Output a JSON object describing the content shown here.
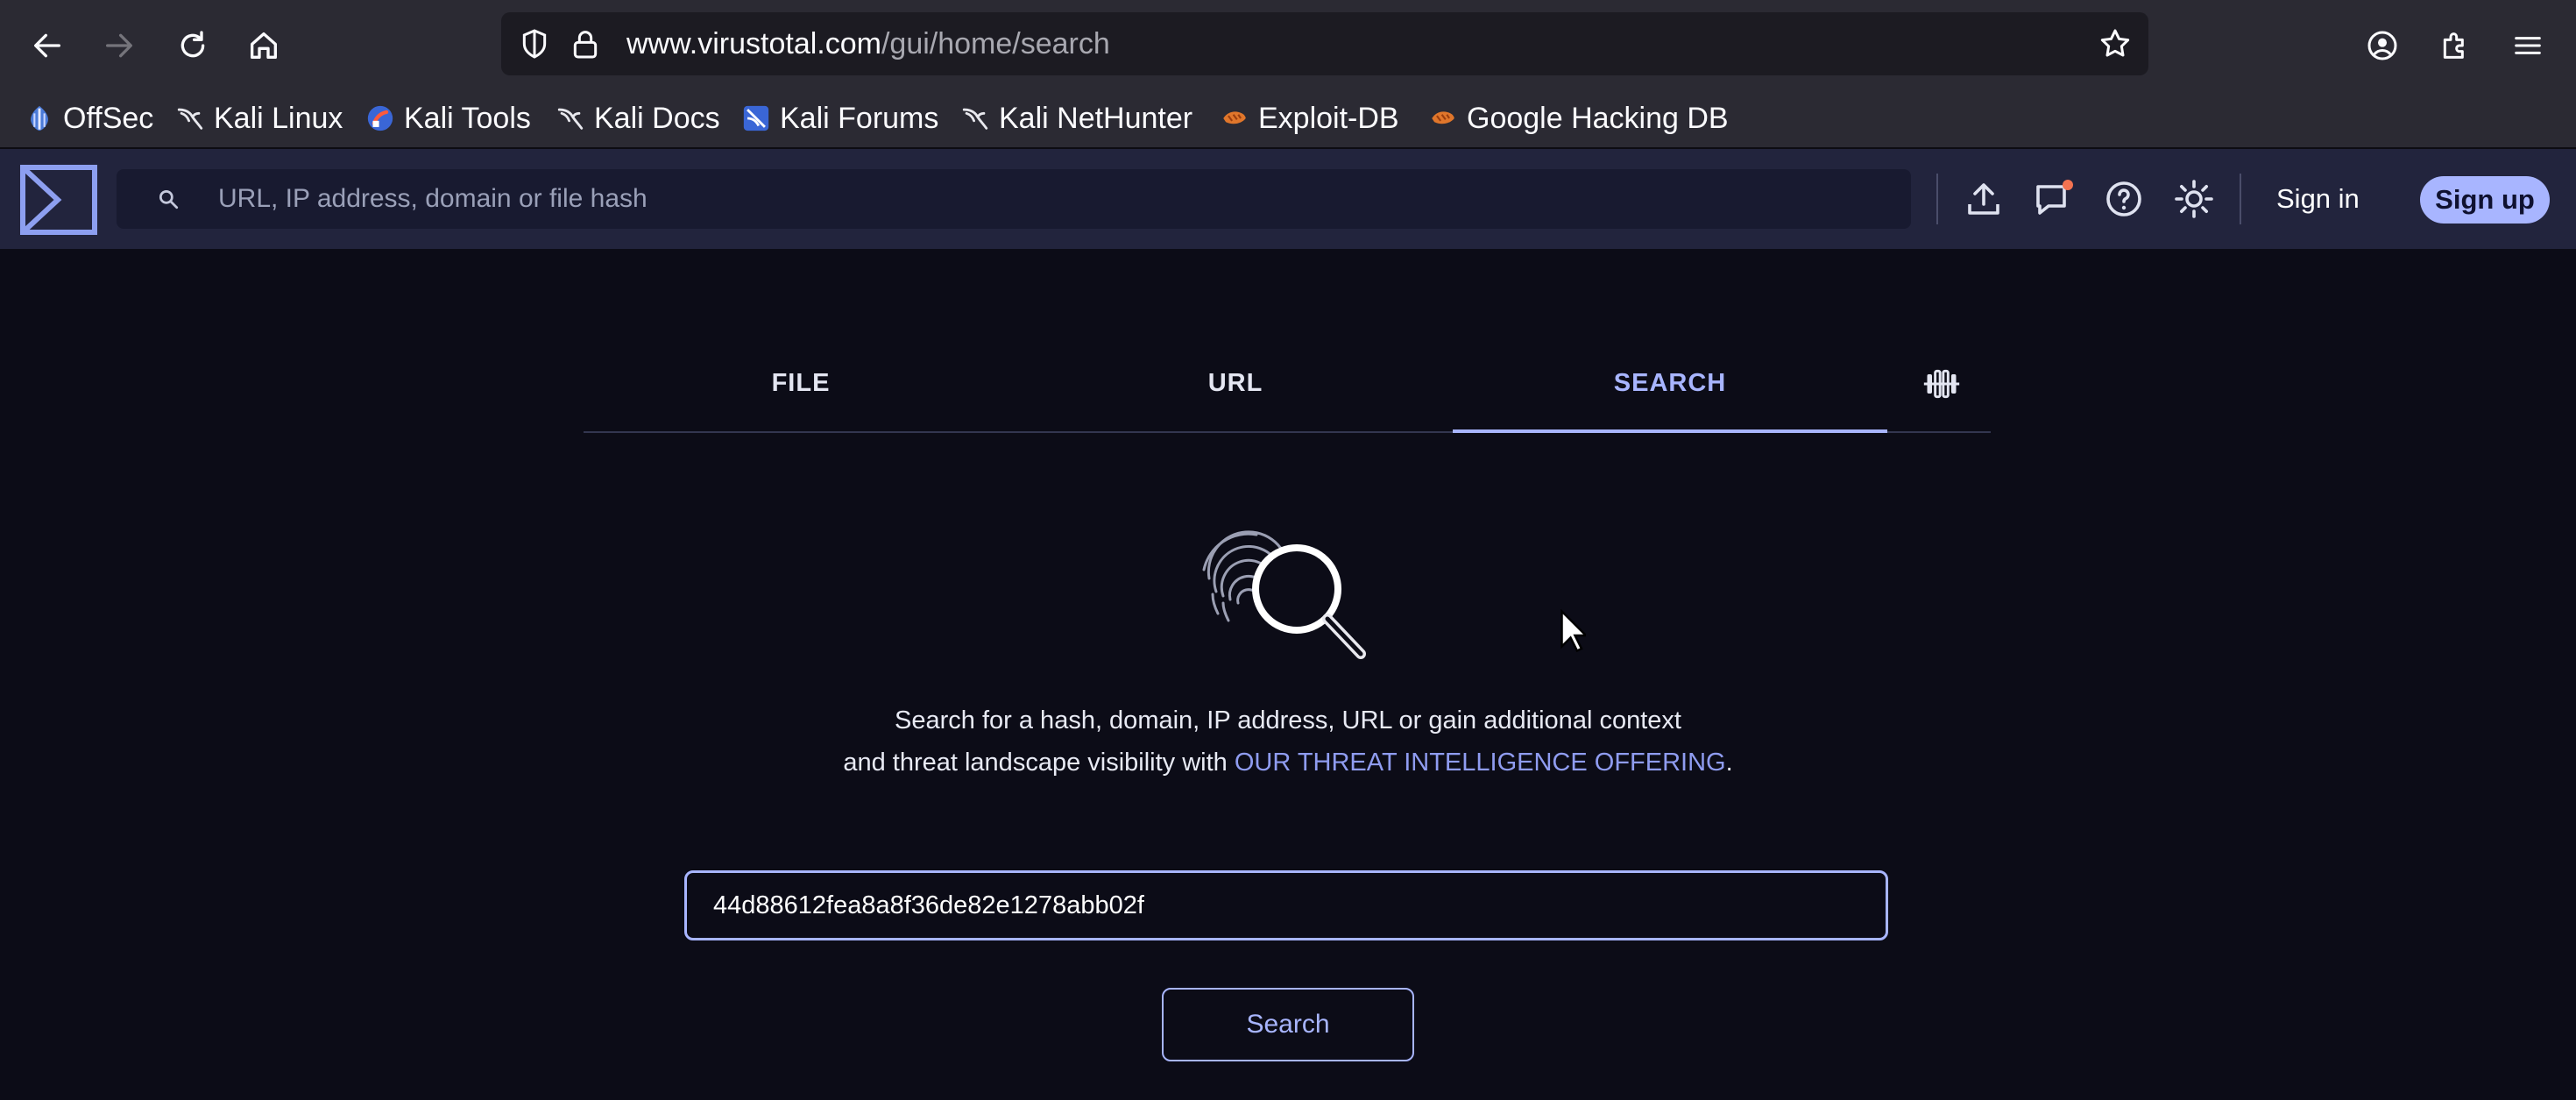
{
  "browser": {
    "url_host": "www.virustotal.com",
    "url_path": "/gui/home/search",
    "bookmarks": [
      {
        "label": "OffSec",
        "icon": "offsec-icon"
      },
      {
        "label": "Kali Linux",
        "icon": "kali-dragon-icon"
      },
      {
        "label": "Kali Tools",
        "icon": "kali-tools-icon"
      },
      {
        "label": "Kali Docs",
        "icon": "kali-dragon-icon"
      },
      {
        "label": "Kali Forums",
        "icon": "kali-forums-icon"
      },
      {
        "label": "Kali NetHunter",
        "icon": "kali-dragon-icon"
      },
      {
        "label": "Exploit-DB",
        "icon": "exploit-db-icon"
      },
      {
        "label": "Google Hacking DB",
        "icon": "exploit-db-icon"
      }
    ]
  },
  "header": {
    "search_placeholder": "URL, IP address, domain or file hash",
    "signin_label": "Sign in",
    "signup_label": "Sign up",
    "accent_color": "#a8b5ff"
  },
  "tabs": [
    {
      "label": "FILE"
    },
    {
      "label": "URL"
    },
    {
      "label": "SEARCH",
      "active": true
    }
  ],
  "main": {
    "description_line1": "Search for a hash, domain, IP address, URL or gain additional context",
    "description_line2": "and threat landscape visibility with ",
    "description_link": "OUR THREAT INTELLIGENCE OFFERING",
    "description_end": ".",
    "hash_value": "44d88612fea8a8f36de82e1278abb02f",
    "search_button": "Search"
  }
}
